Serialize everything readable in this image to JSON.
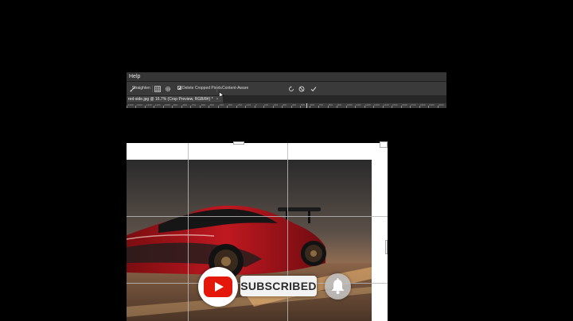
{
  "menu": {
    "help": "Help"
  },
  "options_bar": {
    "straighten_label": "Straighten",
    "delete_cropped_pixels_label": "Delete Cropped Pixels",
    "delete_cropped_pixels_checked": true,
    "content_aware_label": "Content-Aware",
    "icons": [
      "straighten-icon",
      "grid-overlay-icon",
      "gear-icon",
      "reset-icon",
      "cancel-icon",
      "commit-icon"
    ]
  },
  "document_tab": {
    "title": "red-side.jpg @ 16.7% (Crop Preview, RGB/8#) *",
    "close": "×"
  },
  "ruler": {
    "labels": [
      "-1400",
      "-1300",
      "-1200",
      "-1100",
      "-1000",
      "-900",
      "-800",
      "-700",
      "-600",
      "-500",
      "-400",
      "-300",
      "-200",
      "-100",
      "0",
      "100",
      "200",
      "300",
      "400",
      "500",
      "600",
      "700",
      "800",
      "900",
      "1000",
      "1100",
      "1200",
      "1300",
      "1400",
      "1500",
      "1600",
      "1700",
      "1800",
      "1900",
      "2000"
    ]
  },
  "overlay": {
    "subscribed_label": "SUBSCRIBED",
    "accent": "#e3170a"
  }
}
